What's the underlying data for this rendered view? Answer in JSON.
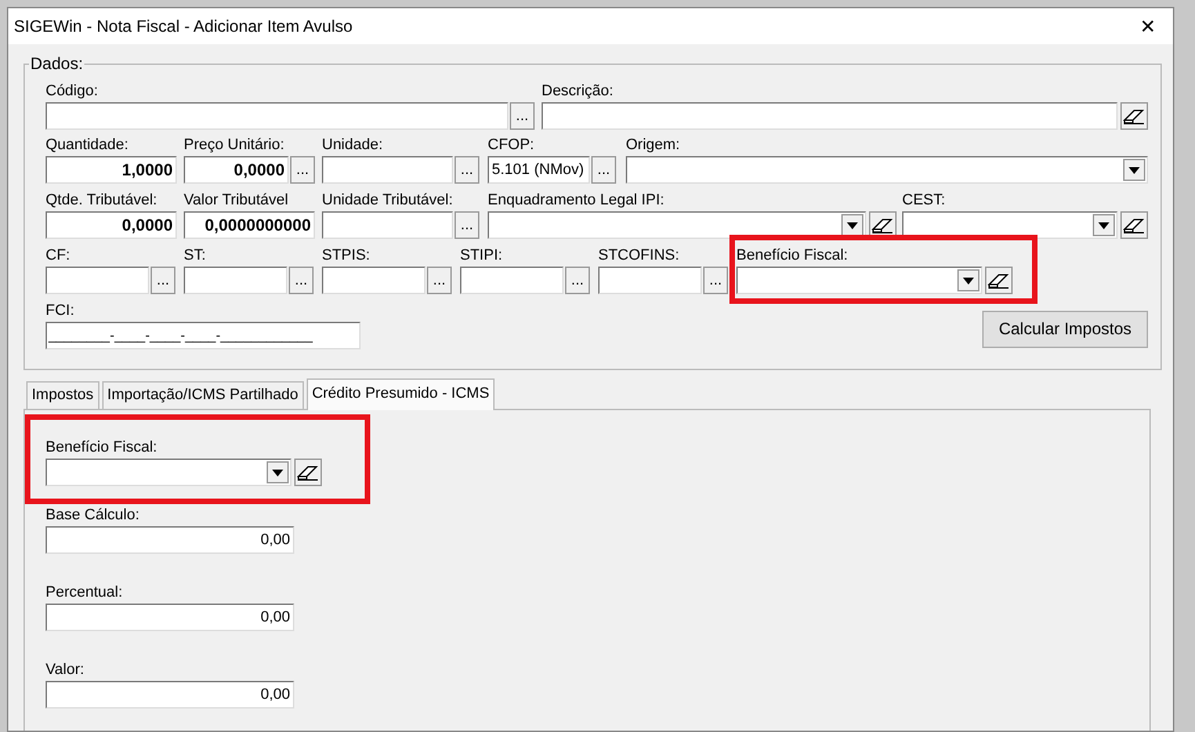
{
  "window": {
    "title": "SIGEWin - Nota Fiscal - Adicionar Item Avulso",
    "close": "✕"
  },
  "dados": {
    "legend": "Dados:",
    "fields": [
      {
        "kind": "text",
        "label": "Código:",
        "lookup": "...",
        "clear": false,
        "highlighted": false
      },
      {
        "kind": "text",
        "label": "Descrição:",
        "clear": true,
        "highlighted": false
      },
      {
        "kind": "number",
        "label": "Quantidade:",
        "value": "1,0000",
        "clear": false,
        "highlighted": false
      },
      {
        "kind": "number",
        "label": "Preço Unitário:",
        "value": "0,0000",
        "lookup": "...",
        "clear": false,
        "highlighted": false
      },
      {
        "kind": "text",
        "label": "Unidade:",
        "lookup": "...",
        "clear": false,
        "highlighted": false
      },
      {
        "kind": "text",
        "label": "CFOP:",
        "value": "5.101 (NMov)",
        "lookup": "...",
        "clear": false,
        "highlighted": false
      },
      {
        "kind": "combo",
        "label": "Origem:",
        "clear": false,
        "highlighted": false
      },
      {
        "kind": "number",
        "label": "Qtde. Tributável:",
        "value": "0,0000",
        "clear": false,
        "highlighted": false
      },
      {
        "kind": "number",
        "label": "Valor Tributável",
        "value": "0,0000000000",
        "clear": false,
        "highlighted": false
      },
      {
        "kind": "text",
        "label": "Unidade Tributável:",
        "lookup": "...",
        "clear": false,
        "highlighted": false
      },
      {
        "kind": "combo",
        "label": "Enquadramento Legal IPI:",
        "clear": true,
        "highlighted": false
      },
      {
        "kind": "combo",
        "label": "CEST:",
        "clear": true,
        "highlighted": false
      },
      {
        "kind": "text",
        "label": "CF:",
        "lookup": "...",
        "clear": false,
        "highlighted": false
      },
      {
        "kind": "text",
        "label": "ST:",
        "lookup": "...",
        "clear": false,
        "highlighted": false
      },
      {
        "kind": "text",
        "label": "STPIS:",
        "lookup": "...",
        "clear": false,
        "highlighted": false
      },
      {
        "kind": "text",
        "label": "STIPI:",
        "lookup": "...",
        "clear": false,
        "highlighted": false
      },
      {
        "kind": "text",
        "label": "STCOFINS:",
        "lookup": "...",
        "clear": false,
        "highlighted": false
      },
      {
        "kind": "combo",
        "label": "Benefício Fiscal:",
        "clear": true,
        "highlighted": true
      },
      {
        "kind": "mask",
        "label": "FCI:",
        "value": "________-____-____-____-____________",
        "clear": false,
        "highlighted": false
      }
    ],
    "button": "Calcular Impostos"
  },
  "tabs": [
    {
      "label": "Impostos",
      "selected": false
    },
    {
      "label": "Importação/ICMS Partilhado",
      "selected": false
    },
    {
      "label": "Crédito Presumido - ICMS",
      "selected": true
    }
  ],
  "tab_fields": [
    {
      "kind": "combo",
      "label": "Benefício Fiscal:",
      "clear": true,
      "highlighted": true
    },
    {
      "kind": "number",
      "label": "Base Cálculo:",
      "value": "0,00",
      "clear": false,
      "highlighted": false
    },
    {
      "kind": "number",
      "label": "Percentual:",
      "value": "0,00",
      "clear": false,
      "highlighted": false
    },
    {
      "kind": "number",
      "label": "Valor:",
      "value": "0,00",
      "clear": false,
      "highlighted": false
    }
  ]
}
